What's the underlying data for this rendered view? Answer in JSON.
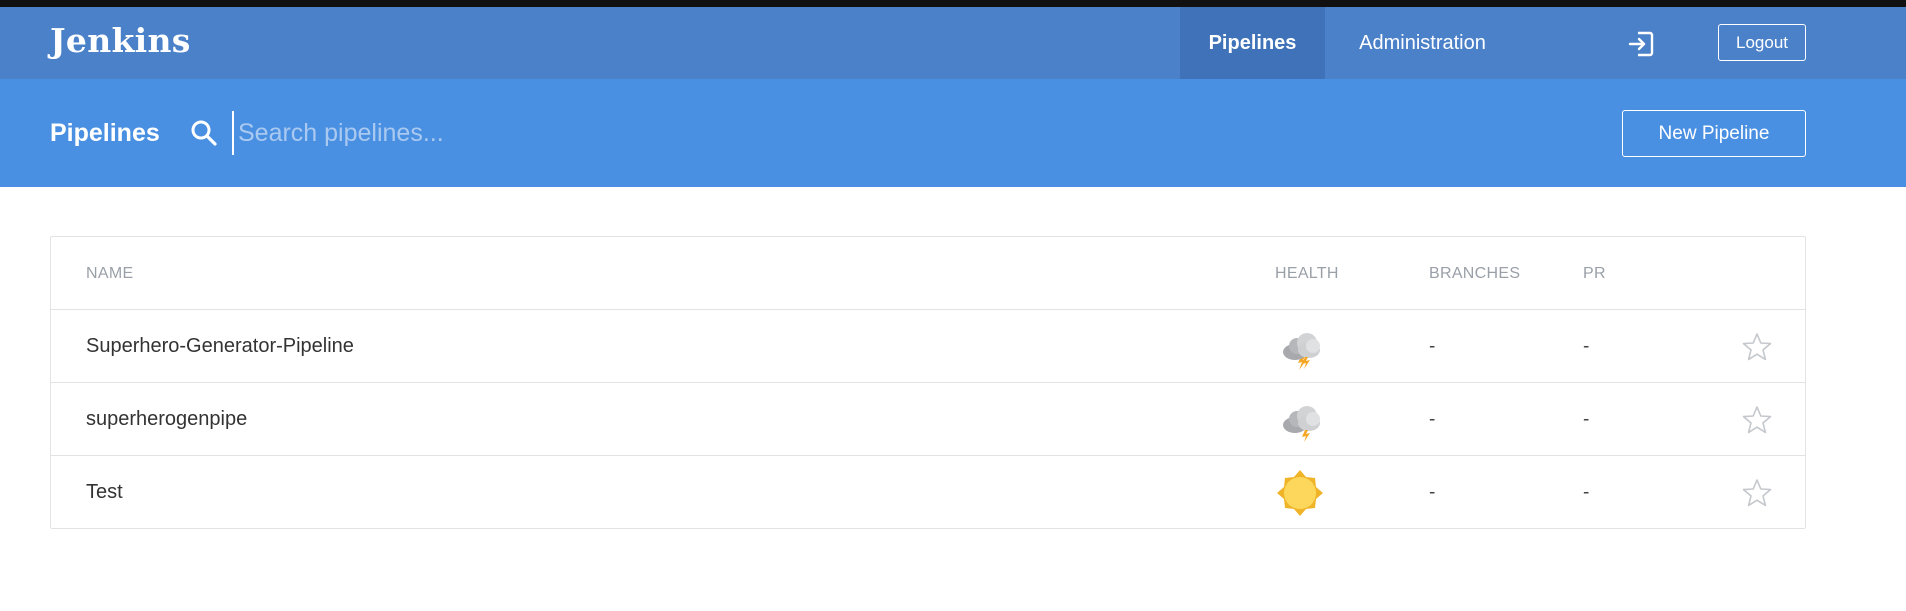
{
  "header": {
    "logo": "Jenkins",
    "nav": [
      {
        "label": "Pipelines",
        "active": true
      },
      {
        "label": "Administration",
        "active": false
      }
    ],
    "logout_label": "Logout"
  },
  "subheader": {
    "title": "Pipelines",
    "search_placeholder": "Search pipelines...",
    "new_pipeline_label": "New Pipeline"
  },
  "table": {
    "columns": [
      "NAME",
      "HEALTH",
      "BRANCHES",
      "PR"
    ],
    "rows": [
      {
        "name": "Superhero-Generator-Pipeline",
        "health": "stormy-icon",
        "branches": "-",
        "pr": "-"
      },
      {
        "name": "superherogenpipe",
        "health": "stormy-icon",
        "branches": "-",
        "pr": "-"
      },
      {
        "name": "Test",
        "health": "sunny-icon",
        "branches": "-",
        "pr": "-"
      }
    ]
  },
  "colors": {
    "header": "#4a81c9",
    "subheader": "#4a90e2",
    "active_nav": "#3f72b8"
  }
}
